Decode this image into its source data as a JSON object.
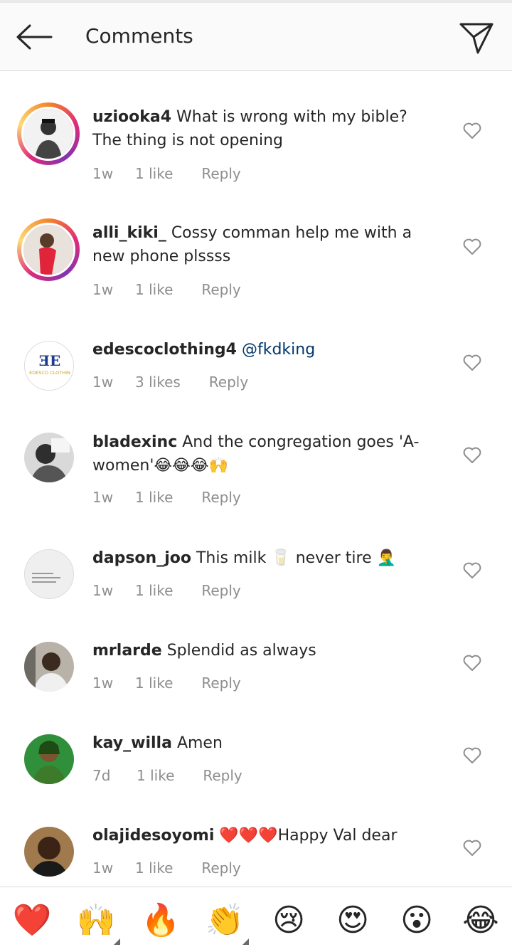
{
  "header": {
    "title": "Comments"
  },
  "comments": [
    {
      "user": "uziooka4",
      "text": "What is wrong with my bible? The thing is not opening",
      "time": "1w",
      "likes": "1 like",
      "reply": "Reply",
      "mention": ""
    },
    {
      "user": "alli_kiki_",
      "text": "Cossy comman help me with a new phone plssss",
      "time": "1w",
      "likes": "1 like",
      "reply": "Reply",
      "mention": ""
    },
    {
      "user": "edescoclothing4",
      "text": "",
      "mention": "@fkdking",
      "time": "1w",
      "likes": "3 likes",
      "reply": "Reply",
      "logo_text": "EDESCO CLOTHIN"
    },
    {
      "user": "bladexinc",
      "text": "And the congregation goes 'A-women'😂😂😂🙌",
      "time": "1w",
      "likes": "1 like",
      "reply": "Reply",
      "mention": ""
    },
    {
      "user": "dapson_joo",
      "text": "This milk 🥛 never tire 🤦‍♂️",
      "time": "1w",
      "likes": "1 like",
      "reply": "Reply",
      "mention": ""
    },
    {
      "user": "mrlarde",
      "text": "Splendid as always",
      "time": "1w",
      "likes": "1 like",
      "reply": "Reply",
      "mention": ""
    },
    {
      "user": "kay_willa",
      "text": "Amen",
      "time": "7d",
      "likes": "1 like",
      "reply": "Reply",
      "mention": ""
    },
    {
      "user": "olajidesoyomi",
      "text": "❤️❤️❤️Happy Val dear",
      "time": "1w",
      "likes": "1 like",
      "reply": "Reply",
      "mention": ""
    }
  ],
  "quick_reactions": [
    "❤️",
    "🙌",
    "🔥",
    "👏",
    "😢",
    "😍",
    "😮",
    "😂"
  ],
  "colors": {
    "link": "#00376b",
    "meta": "#8e8e8e",
    "ring_start": "#f58529",
    "ring_end": "#dd2a7b"
  },
  "icons": {
    "back": "arrow-left-icon",
    "send": "paper-plane-icon",
    "like": "heart-outline-icon"
  }
}
